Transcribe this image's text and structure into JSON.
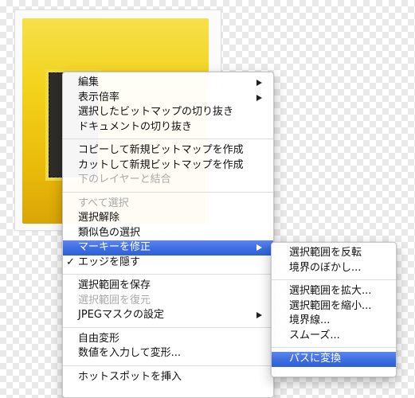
{
  "context_menu": {
    "items": [
      {
        "label": "編集",
        "submenu": true
      },
      {
        "label": "表示倍率",
        "submenu": true
      },
      {
        "label": "選択したビットマップの切り抜き"
      },
      {
        "label": "ドキュメントの切り抜き"
      },
      {
        "label": "コピーして新規ビットマップを作成"
      },
      {
        "label": "カットして新規ビットマップを作成"
      },
      {
        "label": "下のレイヤーと結合",
        "disabled": true
      },
      {
        "label": "すべて選択",
        "disabled": true
      },
      {
        "label": "選択解除"
      },
      {
        "label": "類似色の選択"
      },
      {
        "label": "マーキーを修正",
        "submenu": true,
        "highlighted": true
      },
      {
        "label": "エッジを隠す",
        "checked": true,
        "check_mark": "✓"
      },
      {
        "label": "選択範囲を保存"
      },
      {
        "label": "選択範囲を復元",
        "disabled": true
      },
      {
        "label": "JPEGマスクの設定",
        "submenu": true
      },
      {
        "label": "自由変形"
      },
      {
        "label": "数値を入力して変形..."
      },
      {
        "label": "ホットスポットを挿入"
      }
    ]
  },
  "submenu": {
    "items": [
      {
        "label": "選択範囲を反転"
      },
      {
        "label": "境界のぼかし..."
      },
      {
        "label": "選択範囲を拡大..."
      },
      {
        "label": "選択範囲を縮小..."
      },
      {
        "label": "境界線..."
      },
      {
        "label": "スムーズ..."
      },
      {
        "label": "パスに変換",
        "highlighted": true
      }
    ]
  },
  "colors": {
    "highlight": "#3e6fe2",
    "image_yellow": "#f3d21a",
    "dark_tile": "#2e2d29"
  }
}
